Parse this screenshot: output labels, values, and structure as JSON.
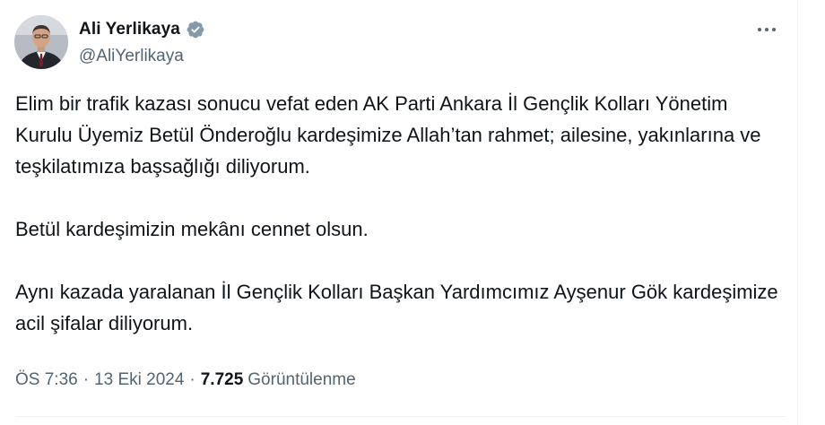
{
  "author": {
    "display_name": "Ali Yerlikaya",
    "handle": "@AliYerlikaya",
    "verified": true,
    "verified_color": "#829aab",
    "avatar_icon": "profile-photo"
  },
  "post": {
    "paragraphs": [
      "Elim bir trafik kazası sonucu vefat eden AK Parti Ankara İl Gençlik Kolları Yönetim Kurulu Üyemiz Betül Önderoğlu kardeşimize Allah’tan rahmet; ailesine, yakınlarına ve teşkilatımıza başsağlığı diliyorum.",
      "Betül kardeşimizin mekânı cennet olsun.",
      "Aynı kazada yaralanan İl Gençlik Kolları Başkan Yardımcımız Ayşenur Gök kardeşimize acil şifalar diliyorum."
    ]
  },
  "meta": {
    "time": "ÖS 7:36",
    "separator": "·",
    "date": "13 Eki 2024",
    "views_count": "7.725",
    "views_label": "Görüntülenme"
  },
  "actions": {
    "more_icon": "more-horizontal-icon"
  },
  "colors": {
    "text_primary": "#0f1419",
    "text_secondary": "#536471",
    "divider": "#eff3f4"
  }
}
